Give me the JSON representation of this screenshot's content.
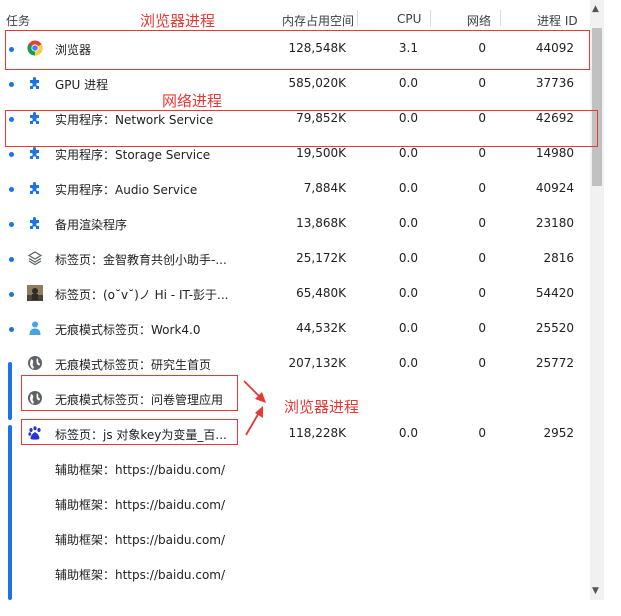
{
  "header": {
    "task": "任务",
    "memory": "内存占用空间",
    "cpu": "CPU",
    "network": "网络",
    "pid": "进程 ID"
  },
  "rows": [
    {
      "task": "浏览器",
      "memory": "128,548K",
      "cpu": "3.1",
      "network": "0",
      "pid": "44092",
      "icon": "chrome-icon"
    },
    {
      "task": "GPU 进程",
      "memory": "585,020K",
      "cpu": "0.0",
      "network": "0",
      "pid": "37736",
      "icon": "puzzle-icon"
    },
    {
      "task": "实用程序：Network Service",
      "memory": "79,852K",
      "cpu": "0.0",
      "network": "0",
      "pid": "42692",
      "icon": "puzzle-icon"
    },
    {
      "task": "实用程序：Storage Service",
      "memory": "19,500K",
      "cpu": "0.0",
      "network": "0",
      "pid": "14980",
      "icon": "puzzle-icon"
    },
    {
      "task": "实用程序：Audio Service",
      "memory": "7,884K",
      "cpu": "0.0",
      "network": "0",
      "pid": "40924",
      "icon": "puzzle-icon"
    },
    {
      "task": "备用渲染程序",
      "memory": "13,868K",
      "cpu": "0.0",
      "network": "0",
      "pid": "23180",
      "icon": "puzzle-icon"
    },
    {
      "task": "标签页：金智教育共创小助手-...",
      "memory": "25,172K",
      "cpu": "0.0",
      "network": "0",
      "pid": "2816",
      "icon": "layers-icon"
    },
    {
      "task": "标签页：(o˘v˘)ノ Hi - IT-彭于...",
      "memory": "65,480K",
      "cpu": "0.0",
      "network": "0",
      "pid": "54420",
      "icon": "avatar-thumbnail-icon"
    },
    {
      "task": "无痕模式标签页：Work4.0",
      "memory": "44,532K",
      "cpu": "0.0",
      "network": "0",
      "pid": "25520",
      "icon": "person-icon"
    },
    {
      "task": "无痕模式标签页：研究生首页",
      "memory": "207,132K",
      "cpu": "0.0",
      "network": "0",
      "pid": "25772",
      "icon": "globe-icon"
    },
    {
      "task": "无痕模式标签页：问卷管理应用",
      "memory": "",
      "cpu": "",
      "network": "",
      "pid": "",
      "icon": "globe-icon"
    },
    {
      "task": "标签页：js 对象key为变量_百...",
      "memory": "118,228K",
      "cpu": "0.0",
      "network": "0",
      "pid": "2952",
      "icon": "baidu-paw-icon"
    },
    {
      "task": "辅助框架：https://baidu.com/",
      "memory": "",
      "cpu": "",
      "network": "",
      "pid": "",
      "icon": ""
    },
    {
      "task": "辅助框架：https://baidu.com/",
      "memory": "",
      "cpu": "",
      "network": "",
      "pid": "",
      "icon": ""
    },
    {
      "task": "辅助框架：https://baidu.com/",
      "memory": "",
      "cpu": "",
      "network": "",
      "pid": "",
      "icon": ""
    },
    {
      "task": "辅助框架：https://baidu.com/",
      "memory": "",
      "cpu": "",
      "network": "",
      "pid": "",
      "icon": ""
    }
  ],
  "annotations": {
    "browser_process": "浏览器进程",
    "network_process": "网络进程",
    "browser_process_2": "浏览器进程"
  },
  "colors": {
    "accent": "#1a73e8",
    "annotation": "#e53935"
  }
}
